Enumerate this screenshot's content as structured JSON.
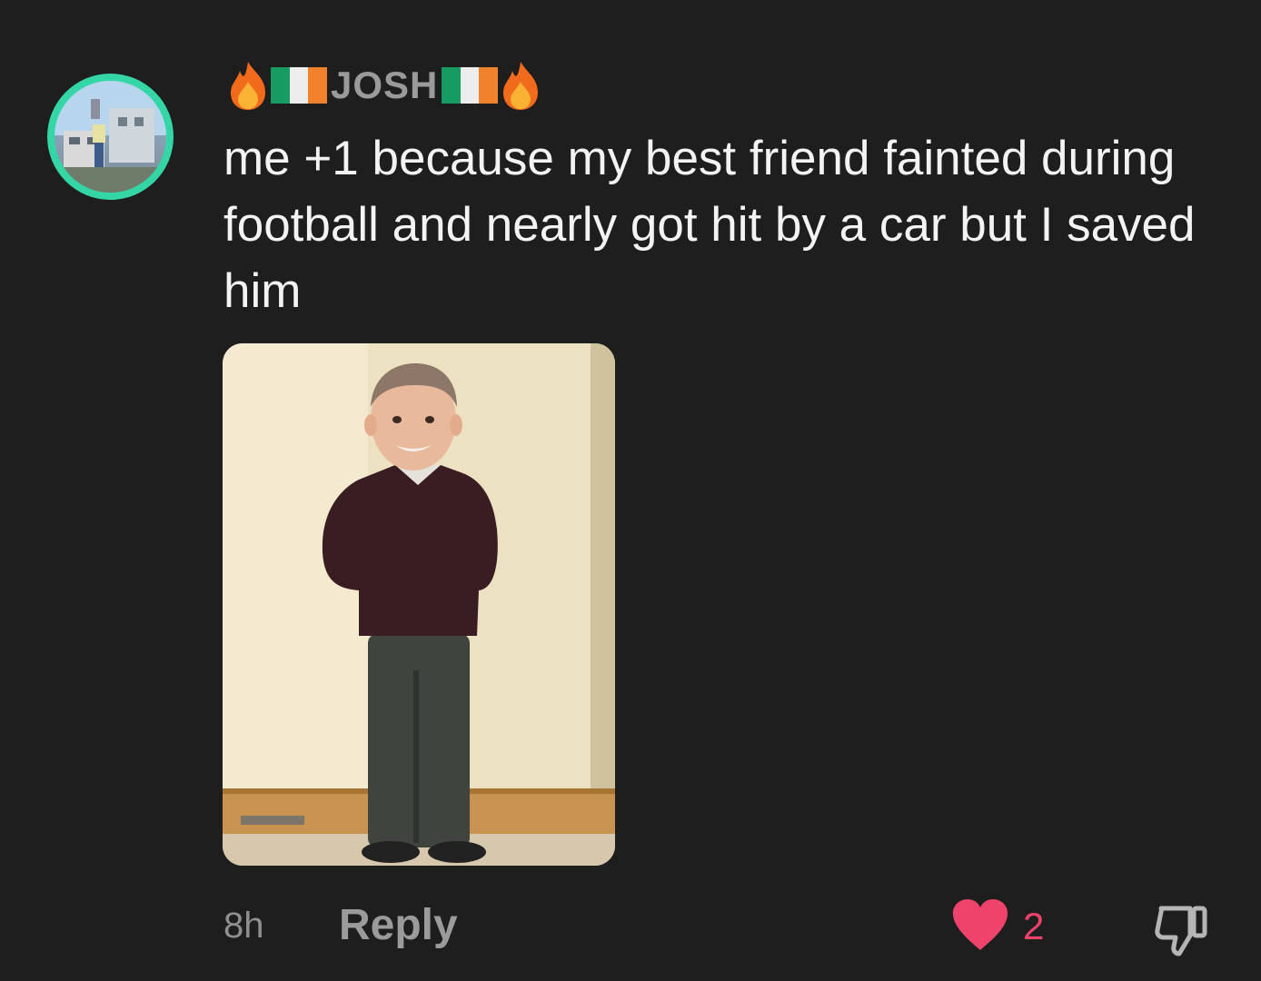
{
  "comment": {
    "author": {
      "prefix_emoji": "🔥🇮🇪",
      "name": "JOSH",
      "suffix_emoji": "🇮🇪🔥",
      "avatar_icon": "avatar-image"
    },
    "text": "me +1 because my best friend fainted during football and nearly got hit by a car but I saved him",
    "attachment": {
      "type": "photo"
    },
    "timestamp": "8h",
    "reply_label": "Reply",
    "likes": "2",
    "like_icon": "heart-icon",
    "dislike_icon": "thumbs-down-icon"
  },
  "colors": {
    "background": "#1e1e1f",
    "avatar_ring": "#35d6a6",
    "like": "#f0436b",
    "muted_text": "#9a9a9a"
  }
}
